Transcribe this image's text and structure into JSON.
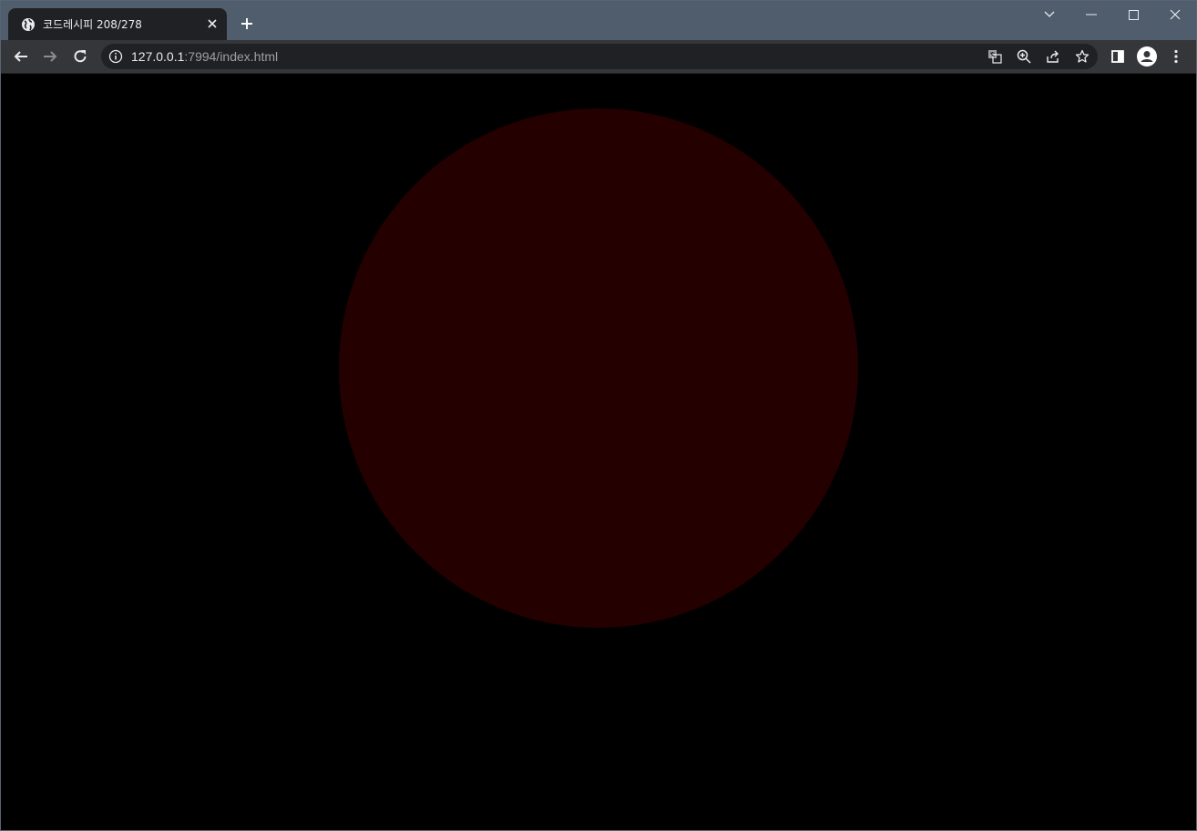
{
  "tab": {
    "title": "코드레시피 208/278",
    "favicon": "globe-icon"
  },
  "address_bar": {
    "host": "127.0.0.1",
    "rest": ":7994/index.html"
  },
  "icons": {
    "back": "arrow-left-icon",
    "forward": "arrow-right-icon",
    "reload": "reload-icon",
    "site_info": "info-icon",
    "translate": "translate-icon",
    "zoom": "zoom-icon",
    "share": "share-icon",
    "bookmark": "star-icon",
    "side_panel": "side-panel-icon",
    "profile": "profile-icon",
    "menu": "kebab-menu-icon"
  },
  "colors": {
    "page_background": "#000000",
    "circle_fill": "#240000"
  }
}
